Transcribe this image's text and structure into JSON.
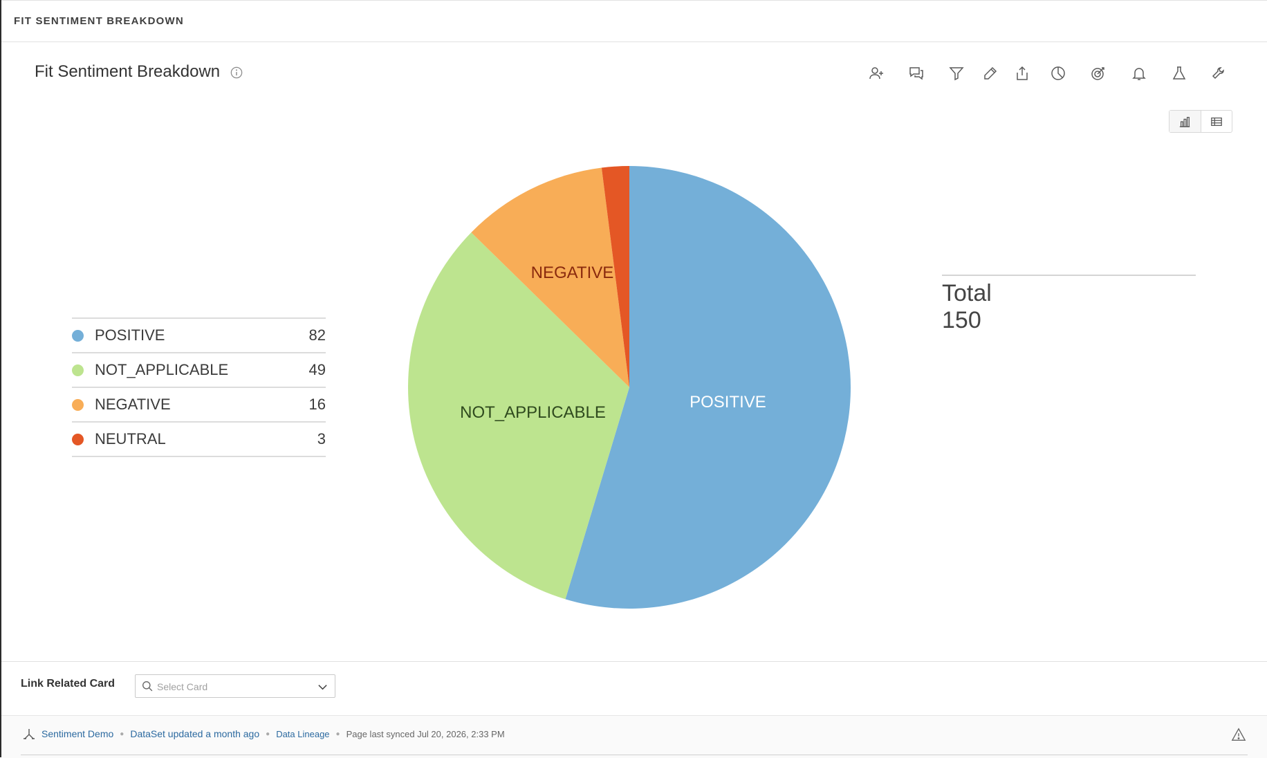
{
  "topbar": {
    "title": "FIT SENTIMENT BREAKDOWN"
  },
  "card": {
    "title": "Fit Sentiment Breakdown"
  },
  "toolbar": {
    "icons": [
      "share-user-icon",
      "comment-icon",
      "filter-icon",
      "edit-icon",
      "export-icon",
      "pie-chart-icon",
      "target-icon",
      "bell-icon",
      "flask-icon",
      "wrench-icon"
    ]
  },
  "view_toggle": [
    "chart-view-icon",
    "table-view-icon"
  ],
  "legend": [
    {
      "label": "POSITIVE",
      "value": "82",
      "color": "#74afd8"
    },
    {
      "label": "NOT_APPLICABLE",
      "value": "49",
      "color": "#bde48f"
    },
    {
      "label": "NEGATIVE",
      "value": "16",
      "color": "#f8ad57"
    },
    {
      "label": "NEUTRAL",
      "value": "3",
      "color": "#e45725"
    }
  ],
  "summary": {
    "label": "Total",
    "value": "150"
  },
  "chart_data": {
    "type": "pie",
    "categories": [
      "POSITIVE",
      "NOT_APPLICABLE",
      "NEGATIVE",
      "NEUTRAL"
    ],
    "values": [
      82,
      49,
      16,
      3
    ],
    "colors": [
      "#74afd8",
      "#bde48f",
      "#f8ad57",
      "#e45725"
    ],
    "slice_labels": [
      "POSITIVE",
      "NOT_APPLICABLE",
      "NEGATIVE",
      ""
    ],
    "label_colors": [
      "#ffffff",
      "#2f4a1e",
      "#8a2a0e",
      "#ffffff"
    ],
    "total": 150
  },
  "related": {
    "label": "Link Related Card",
    "placeholder": "Select Card"
  },
  "footer": {
    "dataset": "Sentiment Demo",
    "updated": "DataSet updated a month ago",
    "lineage": "Data Lineage",
    "synced": "Page last synced Jul 20, 2026, 2:33 PM"
  }
}
